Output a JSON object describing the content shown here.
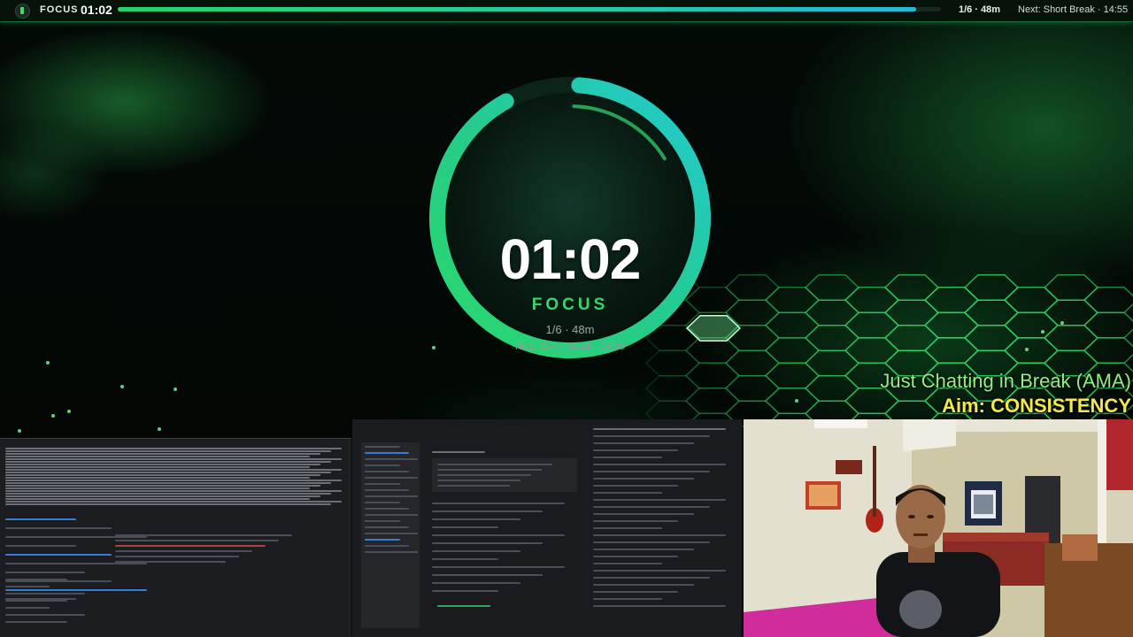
{
  "topbar": {
    "mode_label": "FOCUS",
    "time": "01:02",
    "progress_fraction": 0.97,
    "session": "1/6 · 48m",
    "next": "Next: Short Break · 14:55"
  },
  "timer": {
    "time": "01:02",
    "mode": "FOCUS",
    "session": "1/6 · 48m",
    "next": "Next: Short Break · 14:55",
    "ring_fraction": 0.97
  },
  "overlay": {
    "title": "Just Chatting in Break (AMA)",
    "aim": "Aim: CONSISTENCY"
  },
  "colors": {
    "accent_green": "#36d76a",
    "accent_teal": "#22c9c4",
    "title_green": "#8ef27e",
    "aim_yellow": "#f4e84a"
  },
  "icons": {
    "app": "app-icon",
    "hexagon": "hexagon-decoration"
  }
}
